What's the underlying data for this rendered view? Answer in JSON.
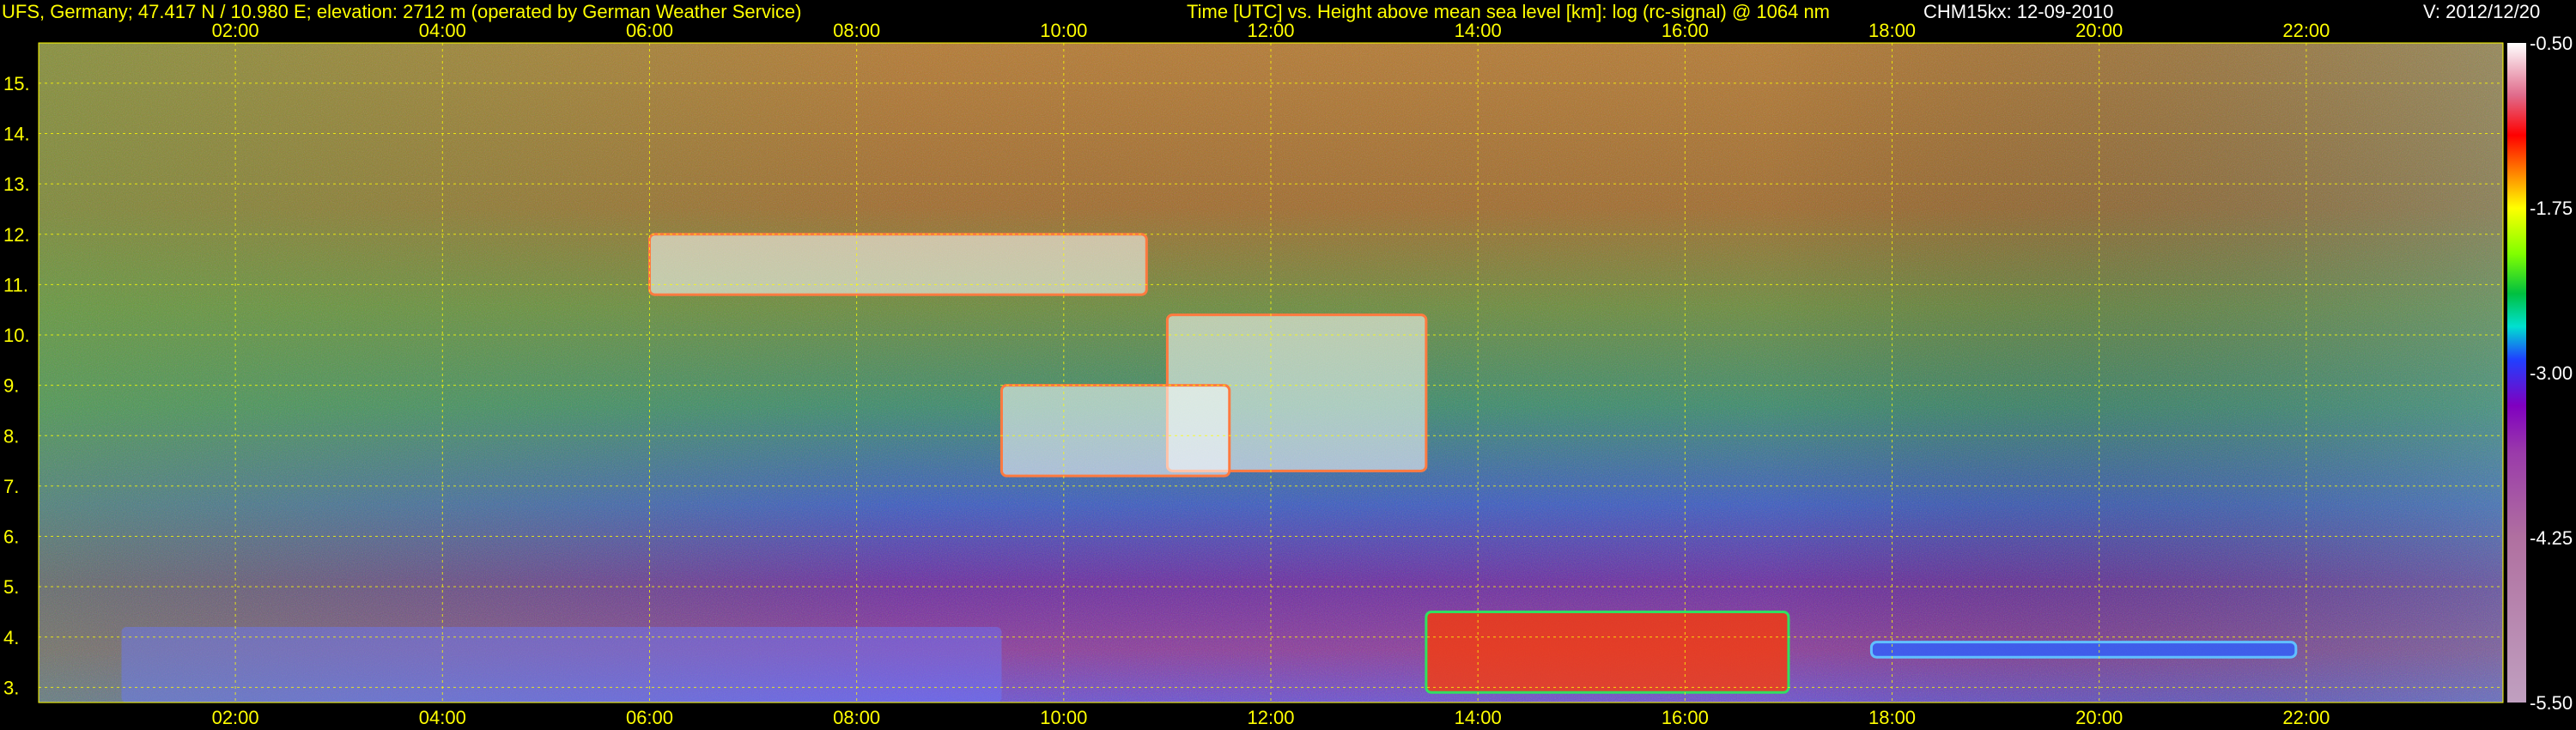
{
  "header": {
    "site": "UFS, Germany; 47.417 N / 10.980 E; elevation: 2712 m  (operated by German Weather Service)",
    "axis_title": "Time [UTC] vs. Height above mean sea level [km]: log (rc-signal) @ 1064 nm",
    "instrument": "CHM15kx: 12-09-2010",
    "version": "V: 2012/12/20"
  },
  "chart_data": {
    "type": "heatmap",
    "title": "Time [UTC] vs. Height above mean sea level [km]: log (rc-signal) @ 1064 nm",
    "xlabel": "Time [UTC]",
    "ylabel": "Height above mean sea level [km]",
    "x_ticks": [
      "02:00",
      "04:00",
      "06:00",
      "08:00",
      "10:00",
      "12:00",
      "14:00",
      "16:00",
      "18:00",
      "20:00",
      "22:00"
    ],
    "x_tick_hours": [
      2,
      4,
      6,
      8,
      10,
      12,
      14,
      16,
      18,
      20,
      22
    ],
    "xlim_hours": [
      0.1,
      23.9
    ],
    "y_ticks": [
      "3.",
      "4.",
      "5.",
      "6.",
      "7.",
      "8.",
      "9.",
      "10.",
      "11.",
      "12.",
      "13.",
      "14.",
      "15."
    ],
    "y_tick_values": [
      3,
      4,
      5,
      6,
      7,
      8,
      9,
      10,
      11,
      12,
      13,
      14,
      15
    ],
    "ylim_km": [
      2.7,
      15.8
    ],
    "grid": true,
    "colorbar": {
      "labels": [
        "-0.50",
        "-1.75",
        "-3.00",
        "-4.25",
        "-5.50"
      ],
      "values": [
        -0.5,
        -1.75,
        -3.0,
        -4.25,
        -5.5
      ],
      "range": [
        -5.5,
        -0.5
      ]
    },
    "features": [
      {
        "kind": "cirrus",
        "t_start": 11.0,
        "t_end": 13.5,
        "h_bottom": 7.3,
        "h_top": 10.4
      },
      {
        "kind": "cirrus",
        "t_start": 6.0,
        "t_end": 10.8,
        "h_bottom": 10.8,
        "h_top": 12.0
      },
      {
        "kind": "cirrus",
        "t_start": 9.4,
        "t_end": 11.6,
        "h_bottom": 7.2,
        "h_top": 9.0
      },
      {
        "kind": "boundary_layer",
        "t_start": 13.5,
        "t_end": 17.0,
        "h_bottom": 2.9,
        "h_top": 4.5
      },
      {
        "kind": "aerosol_layer",
        "t_start": 17.8,
        "t_end": 21.9,
        "h_bottom": 3.6,
        "h_top": 3.9
      },
      {
        "kind": "high_signal_ground",
        "t_start": 0.9,
        "t_end": 9.4,
        "h_bottom": 2.7,
        "h_top": 4.2
      }
    ]
  }
}
